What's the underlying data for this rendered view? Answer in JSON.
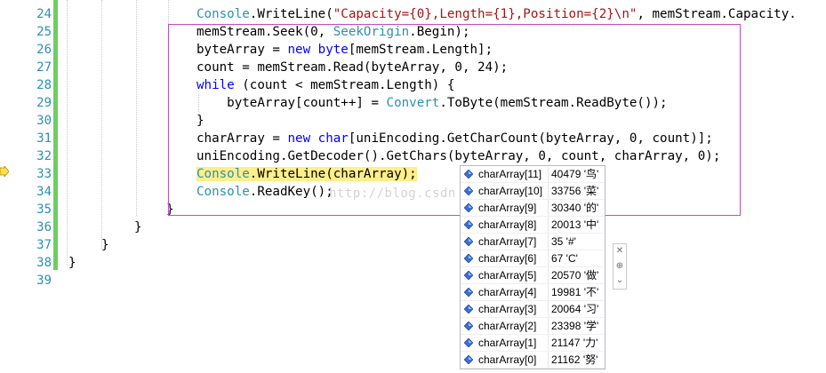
{
  "editor": {
    "lines": [
      {
        "num": "24",
        "tokens": [
          {
            "t": "Console",
            "c": "ty"
          },
          {
            "t": ".WriteLine(",
            "c": ""
          },
          {
            "t": "\"Capacity={0},Length={1},Position={2}\\n\"",
            "c": "st"
          },
          {
            "t": ", memStream.Capacity.",
            "c": ""
          }
        ]
      },
      {
        "num": "25",
        "tokens": [
          {
            "t": "memStream.Seek(0, ",
            "c": ""
          },
          {
            "t": "SeekOrigin",
            "c": "ty"
          },
          {
            "t": ".Begin);",
            "c": ""
          }
        ]
      },
      {
        "num": "26",
        "tokens": [
          {
            "t": "byteArray = ",
            "c": ""
          },
          {
            "t": "new",
            "c": "kw"
          },
          {
            "t": " ",
            "c": ""
          },
          {
            "t": "byte",
            "c": "kw"
          },
          {
            "t": "[memStream.Length];",
            "c": ""
          }
        ]
      },
      {
        "num": "27",
        "tokens": [
          {
            "t": "count = memStream.Read(byteArray, 0, 24);",
            "c": ""
          }
        ]
      },
      {
        "num": "28",
        "tokens": [
          {
            "t": "while",
            "c": "kw"
          },
          {
            "t": " (count < memStream.Length) {",
            "c": ""
          }
        ]
      },
      {
        "num": "29",
        "tokens": [
          {
            "t": "    byteArray[count++] = ",
            "c": ""
          },
          {
            "t": "Convert",
            "c": "ty"
          },
          {
            "t": ".ToByte(memStream.ReadByte());",
            "c": ""
          }
        ]
      },
      {
        "num": "30",
        "tokens": [
          {
            "t": "}",
            "c": ""
          }
        ]
      },
      {
        "num": "31",
        "tokens": [
          {
            "t": "charArray = ",
            "c": ""
          },
          {
            "t": "new",
            "c": "kw"
          },
          {
            "t": " ",
            "c": ""
          },
          {
            "t": "char",
            "c": "kw"
          },
          {
            "t": "[uniEncoding.GetCharCount(byteArray, 0, count)];",
            "c": ""
          }
        ]
      },
      {
        "num": "32",
        "tokens": [
          {
            "t": "uniEncoding.GetDecoder().GetChars(byteArray, 0, count, charArray, 0);",
            "c": ""
          }
        ]
      },
      {
        "num": "33",
        "tokens": [
          {
            "t": "Console",
            "c": "ty hl"
          },
          {
            "t": ".WriteLine(charArray);",
            "c": "hl"
          }
        ]
      },
      {
        "num": "34",
        "tokens": [
          {
            "t": "Console",
            "c": "ty"
          },
          {
            "t": ".ReadKey();",
            "c": ""
          }
        ]
      },
      {
        "num": "35",
        "tokens": [
          {
            "t": "}",
            "c": ""
          }
        ]
      },
      {
        "num": "36",
        "tokens": [
          {
            "t": "}",
            "c": ""
          }
        ]
      },
      {
        "num": "37",
        "tokens": [
          {
            "t": "}",
            "c": ""
          }
        ]
      },
      {
        "num": "38",
        "tokens": [
          {
            "t": "}",
            "c": ""
          }
        ]
      },
      {
        "num": "39",
        "tokens": []
      }
    ]
  },
  "watermark": "http://blog.csdn",
  "datatip": {
    "rows": [
      {
        "name": "charArray[11]",
        "value": "40479 '鸟'"
      },
      {
        "name": "charArray[10]",
        "value": "33756 '菜'"
      },
      {
        "name": "charArray[9]",
        "value": "30340 '的'"
      },
      {
        "name": "charArray[8]",
        "value": "20013 '中'"
      },
      {
        "name": "charArray[7]",
        "value": "35 '#'"
      },
      {
        "name": "charArray[6]",
        "value": "67 'C'"
      },
      {
        "name": "charArray[5]",
        "value": "20570 '做'"
      },
      {
        "name": "charArray[4]",
        "value": "19981 '不'"
      },
      {
        "name": "charArray[3]",
        "value": "20064 '习'"
      },
      {
        "name": "charArray[2]",
        "value": "23398 '学'"
      },
      {
        "name": "charArray[1]",
        "value": "21147 '力'"
      },
      {
        "name": "charArray[0]",
        "value": "21162 '努'"
      }
    ]
  },
  "pin_panel": {
    "close": "✕",
    "pin": "⊕",
    "expand": "⌄"
  },
  "colors": {
    "keyword": "#0000ff",
    "type": "#2b91af",
    "string": "#a31515",
    "highlight": "#ffee8a",
    "change_bar": "#6ccf5f"
  }
}
